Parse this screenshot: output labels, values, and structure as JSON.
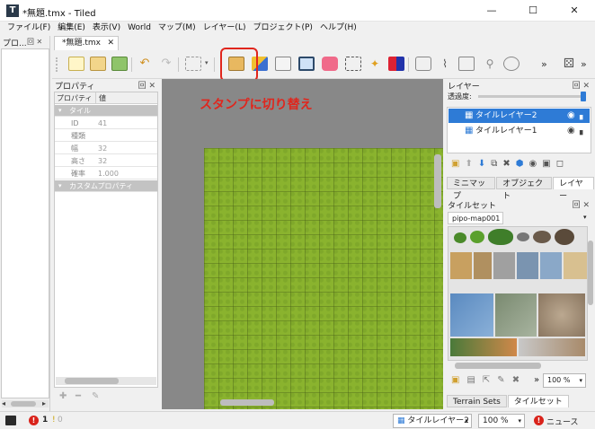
{
  "window": {
    "title": "*無題.tmx - Tiled",
    "app_icon": "T",
    "controls": [
      "—",
      "☐",
      "✕"
    ]
  },
  "menu": [
    "ファイル(F)",
    "編集(E)",
    "表示(V)",
    "World",
    "マップ(M)",
    "レイヤー(L)",
    "プロジェクト(P)",
    "ヘルプ(H)"
  ],
  "left_dock": {
    "title": "プロ...",
    "controls": "回 ✕"
  },
  "document_tab": {
    "label": "*無題.tmx",
    "close": "✕"
  },
  "toolbar": {
    "overflow_label": "»",
    "overflow_label_2": "»"
  },
  "annotation": {
    "text": "スタンプに切り替え",
    "color": "#e0261d"
  },
  "properties": {
    "title": "プロパティ",
    "controls": "回 ✕",
    "col_name": "プロパティ",
    "col_value": "値",
    "section_tile": "タイル",
    "rows": [
      {
        "key": "ID",
        "value": "41"
      },
      {
        "key": "種類",
        "value": ""
      },
      {
        "key": "幅",
        "value": "32"
      },
      {
        "key": "高さ",
        "value": "32"
      },
      {
        "key": "確率",
        "value": "1.000"
      }
    ],
    "section_custom": "カスタムプロパティ",
    "bottom_buttons": [
      "✚",
      "━",
      "✎"
    ]
  },
  "layers_panel": {
    "title": "レイヤー",
    "controls": "回 ✕",
    "opacity_label": "透過度:",
    "layers": [
      {
        "name": "タイルレイヤー2",
        "selected": true
      },
      {
        "name": "タイルレイヤー1",
        "selected": false
      }
    ],
    "tabs": [
      "ミニマップ",
      "オブジェクト",
      "レイヤー"
    ],
    "active_tab": "レイヤー"
  },
  "tileset_panel": {
    "title": "タイルセット",
    "controls": "回 ✕",
    "tileset_tab": "pipo-map001",
    "zoom": "100 %",
    "bottom_tabs": [
      "Terrain Sets",
      "タイルセット"
    ]
  },
  "statusbar": {
    "error_count": "1",
    "warning_count": "0",
    "layer_select": "タイルレイヤー2",
    "zoom_select": "100 %",
    "news_label": "ニュース"
  },
  "colors": {
    "accent": "#e0261d",
    "selection": "#2e7bd6",
    "map_grass": "#8ab32e"
  }
}
